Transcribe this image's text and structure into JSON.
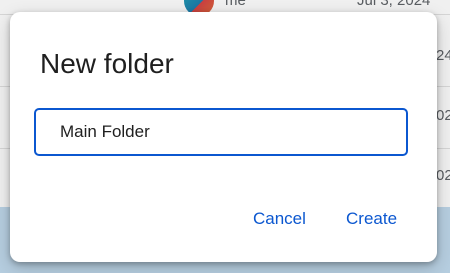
{
  "background": {
    "owner_text": "me",
    "date_text": "Jul 3, 2024",
    "row_fragments": [
      "24",
      "02",
      "02"
    ]
  },
  "dialog": {
    "title": "New folder",
    "input_value": "Main Folder",
    "cancel_label": "Cancel",
    "create_label": "Create"
  },
  "colors": {
    "accent": "#0b57d0",
    "title_text": "#1f1f1f",
    "selected_row": "#c2dbee"
  }
}
